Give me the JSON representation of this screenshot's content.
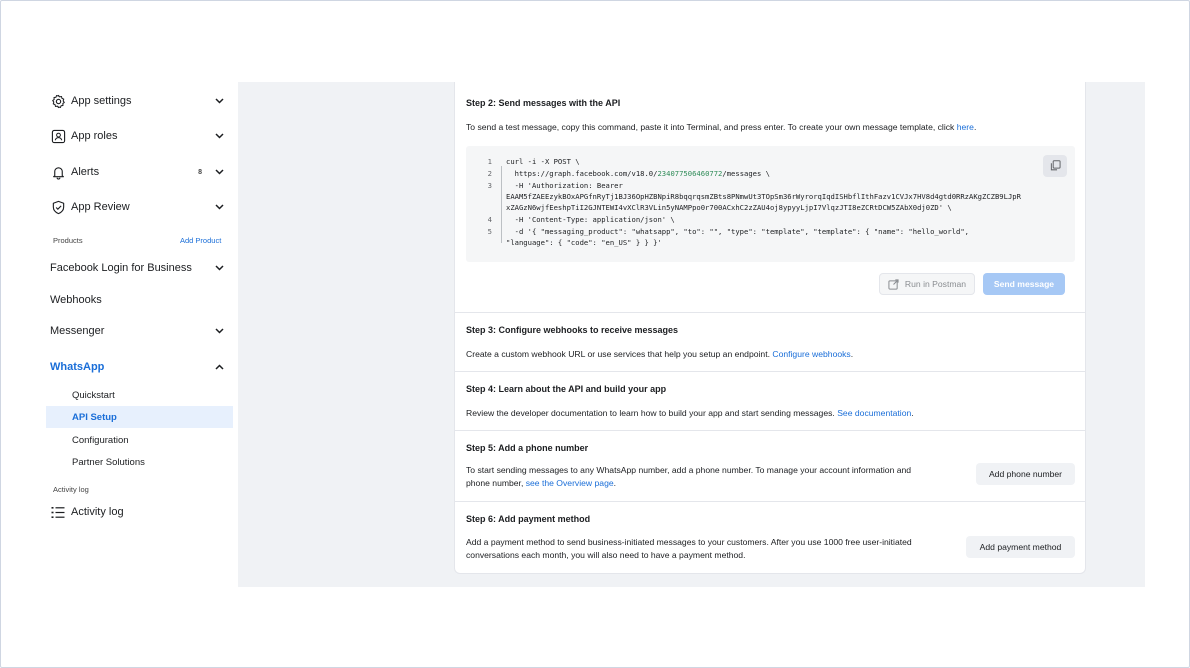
{
  "sidebar": {
    "top_items": [
      {
        "label": "App settings",
        "icon": "gear-icon"
      },
      {
        "label": "App roles",
        "icon": "user-badge-icon"
      },
      {
        "label": "Alerts",
        "icon": "bell-icon",
        "badge": "8"
      },
      {
        "label": "App Review",
        "icon": "shield-check-icon"
      }
    ],
    "products_label": "Products",
    "add_product_label": "Add Product",
    "products": [
      {
        "label": "Facebook Login for Business",
        "expandable": true
      },
      {
        "label": "Webhooks",
        "expandable": false
      },
      {
        "label": "Messenger",
        "expandable": true
      },
      {
        "label": "WhatsApp",
        "expandable": true,
        "active": true
      }
    ],
    "whatsapp_sub": [
      {
        "label": "Quickstart"
      },
      {
        "label": "API Setup",
        "active": true
      },
      {
        "label": "Configuration"
      },
      {
        "label": "Partner Solutions"
      }
    ],
    "activity_label": "Activity log",
    "activity_item": {
      "label": "Activity log",
      "icon": "list-icon"
    }
  },
  "steps": {
    "step2": {
      "title": "Step 2: Send messages with the API",
      "desc_prefix": "To send a test message, copy this command, paste it into Terminal, and press enter. To create your own message template, click ",
      "desc_link": "here",
      "desc_suffix": ".",
      "code": [
        {
          "num": "1",
          "text": "curl -i -X POST \\"
        },
        {
          "num": "2",
          "text_prefix": "  https://graph.facebook.com/v18.0/",
          "text_id": "234077506460772",
          "text_suffix": "/messages \\"
        },
        {
          "num": "3",
          "text": "  -H 'Authorization: Bearer"
        },
        {
          "num": "",
          "text": "EAAM5fZAEEzykBOxAPGfnRyTj1BJ36OpHZBNpiR8bqqrqsmZBts8PNmwUt3TOpSm36rWyrorqIqdISHbflIthFazv1CVJx7HV8d4gtd0RRzAKgZCZB9LJpR"
        },
        {
          "num": "",
          "text": "xZAGzN6wjfEeshpTiI2GJNTEWI4vXClR3VLin5yNAMPpo0r700ACxhC2zZAU4oj8ypyyLjpI7VlqzJTI8eZCRtDCW5ZAbX0dj0ZD' \\"
        },
        {
          "num": "4",
          "text": "  -H 'Content-Type: application/json' \\"
        },
        {
          "num": "5",
          "text": "  -d '{ \"messaging_product\": \"whatsapp\", \"to\": \"\", \"type\": \"template\", \"template\": { \"name\": \"hello_world\","
        },
        {
          "num": "",
          "text": "\"language\": { \"code\": \"en_US\" } } }'"
        }
      ],
      "run_postman_label": "Run in Postman",
      "send_message_label": "Send message"
    },
    "step3": {
      "title": "Step 3: Configure webhooks to receive messages",
      "desc_prefix": "Create a custom webhook URL or use services that help you setup an endpoint. ",
      "desc_link": "Configure webhooks",
      "desc_suffix": "."
    },
    "step4": {
      "title": "Step 4: Learn about the API and build your app",
      "desc_prefix": "Review the developer documentation to learn how to build your app and start sending messages. ",
      "desc_link": "See documentation",
      "desc_suffix": "."
    },
    "step5": {
      "title": "Step 5: Add a phone number",
      "desc_line1": "To start sending messages to any WhatsApp number, add a phone number. To manage your account information and",
      "desc_line2_prefix": "phone number, ",
      "desc_link": "see the Overview page",
      "desc_suffix": ".",
      "button_label": "Add phone number"
    },
    "step6": {
      "title": "Step 6: Add payment method",
      "desc_line1": "Add a payment method to send business-initiated messages to your customers. After you use 1000 free user-initiated",
      "desc_line2": "conversations each month, you will also need to have a payment method.",
      "button_label": "Add payment method"
    }
  },
  "colors": {
    "accent": "#1a6ed8",
    "active_bg": "#e7f0fd",
    "main_bg": "#f0f2f5"
  }
}
